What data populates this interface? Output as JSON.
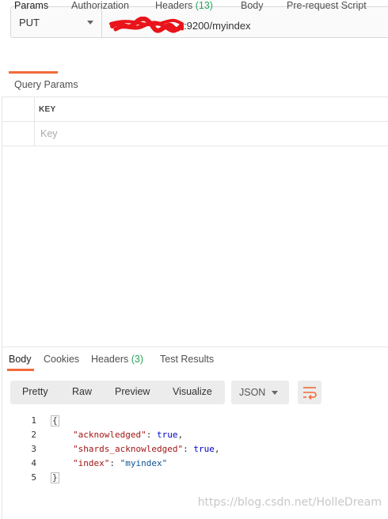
{
  "request": {
    "method": "PUT",
    "url_visible": ":9200/myindex"
  },
  "request_tabs": [
    {
      "label": "Params",
      "active": true
    },
    {
      "label": "Authorization"
    },
    {
      "label": "Headers",
      "count": "(13)"
    },
    {
      "label": "Body"
    },
    {
      "label": "Pre-request Script"
    }
  ],
  "query_params": {
    "title": "Query Params",
    "column_key": "KEY",
    "key_placeholder": "Key"
  },
  "response_tabs": [
    {
      "label": "Body",
      "active": true
    },
    {
      "label": "Cookies"
    },
    {
      "label": "Headers",
      "count": "(3)"
    },
    {
      "label": "Test Results"
    }
  ],
  "view_modes": [
    "Pretty",
    "Raw",
    "Preview",
    "Visualize"
  ],
  "format_select": "JSON",
  "icons": {
    "wrap": "wrap-lines-icon",
    "caret": "chevron-down-icon"
  },
  "colors": {
    "accent": "#f26b3a",
    "count": "#26a65b"
  },
  "response_body": {
    "line_numbers": [
      "1",
      "2",
      "3",
      "4",
      "5"
    ],
    "open_brace": "{",
    "close_brace": "}",
    "lines": [
      {
        "key": "\"acknowledged\"",
        "sep": ": ",
        "value": "true",
        "end": ","
      },
      {
        "key": "\"shards_acknowledged\"",
        "sep": ": ",
        "value": "true",
        "end": ","
      },
      {
        "key": "\"index\"",
        "sep": ": ",
        "value": "\"myindex\"",
        "end": ""
      }
    ]
  },
  "watermark": "https://blog.csdn.net/HolleDream"
}
